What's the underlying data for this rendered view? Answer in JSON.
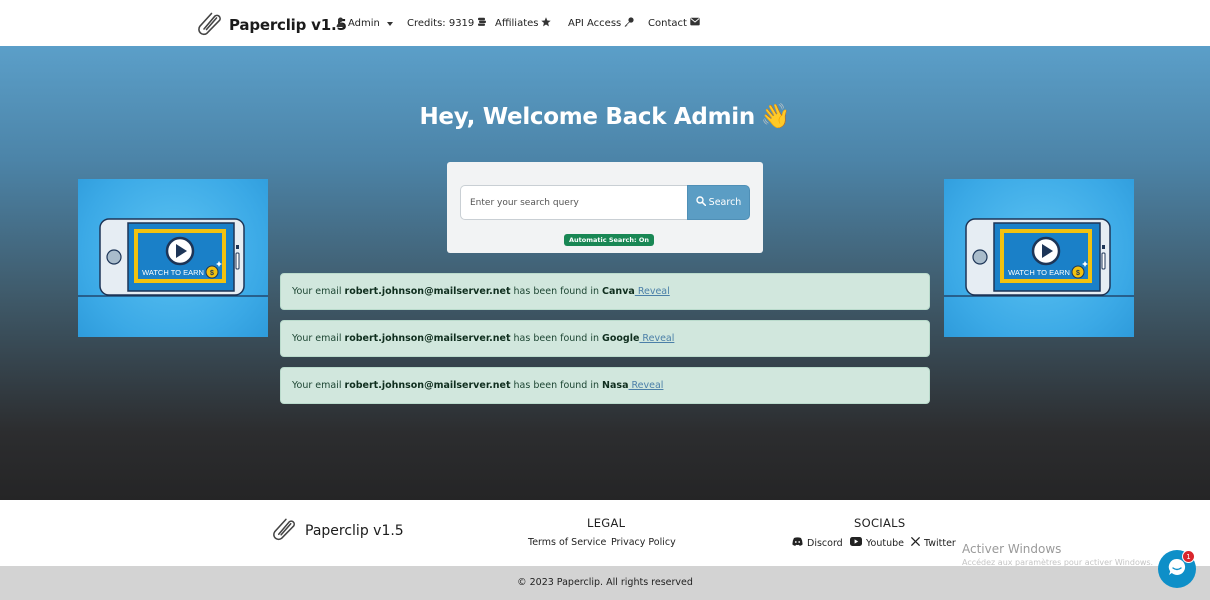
{
  "navbar": {
    "brand": "Paperclip v1.5",
    "user_menu": "Admin",
    "credits": "Credits: 9319",
    "affiliates": "Affiliates",
    "api_access": "API Access",
    "contact": "Contact"
  },
  "hero": {
    "welcome": "Hey, Welcome Back Admin",
    "wave_emoji": "👋"
  },
  "search": {
    "placeholder": "Enter your search query",
    "value": "",
    "button_label": "Search",
    "auto_search_badge": "Automatic Search: On"
  },
  "results": [
    {
      "prefix": "Your email ",
      "email": "robert.johnson@mailserver.net",
      "middle": " has been found in ",
      "site": "Canva",
      "reveal": " Reveal"
    },
    {
      "prefix": "Your email ",
      "email": "robert.johnson@mailserver.net",
      "middle": " has been found in ",
      "site": "Google",
      "reveal": " Reveal"
    },
    {
      "prefix": "Your email ",
      "email": "robert.johnson@mailserver.net",
      "middle": " has been found in ",
      "site": "Nasa",
      "reveal": " Reveal"
    }
  ],
  "ads": {
    "text": "WATCH TO EARN"
  },
  "footer": {
    "brand": "Paperclip v1.5",
    "legal_heading": "LEGAL",
    "terms": "Terms of Service",
    "privacy": "Privacy Policy",
    "socials_heading": "SOCIALS",
    "discord": "Discord",
    "youtube": "Youtube",
    "twitter": "Twitter",
    "copyright": "© 2023 Paperclip. All rights reserved"
  },
  "os_watermark": {
    "title": "Activer Windows",
    "subtitle": "Accédez aux paramètres pour activer Windows."
  },
  "chat": {
    "unread_count": "1"
  },
  "colors": {
    "accent": "#5b9dc4",
    "success_badge": "#198754",
    "alert_bg": "#d1e7dd",
    "chat": "#0e8fc8"
  }
}
